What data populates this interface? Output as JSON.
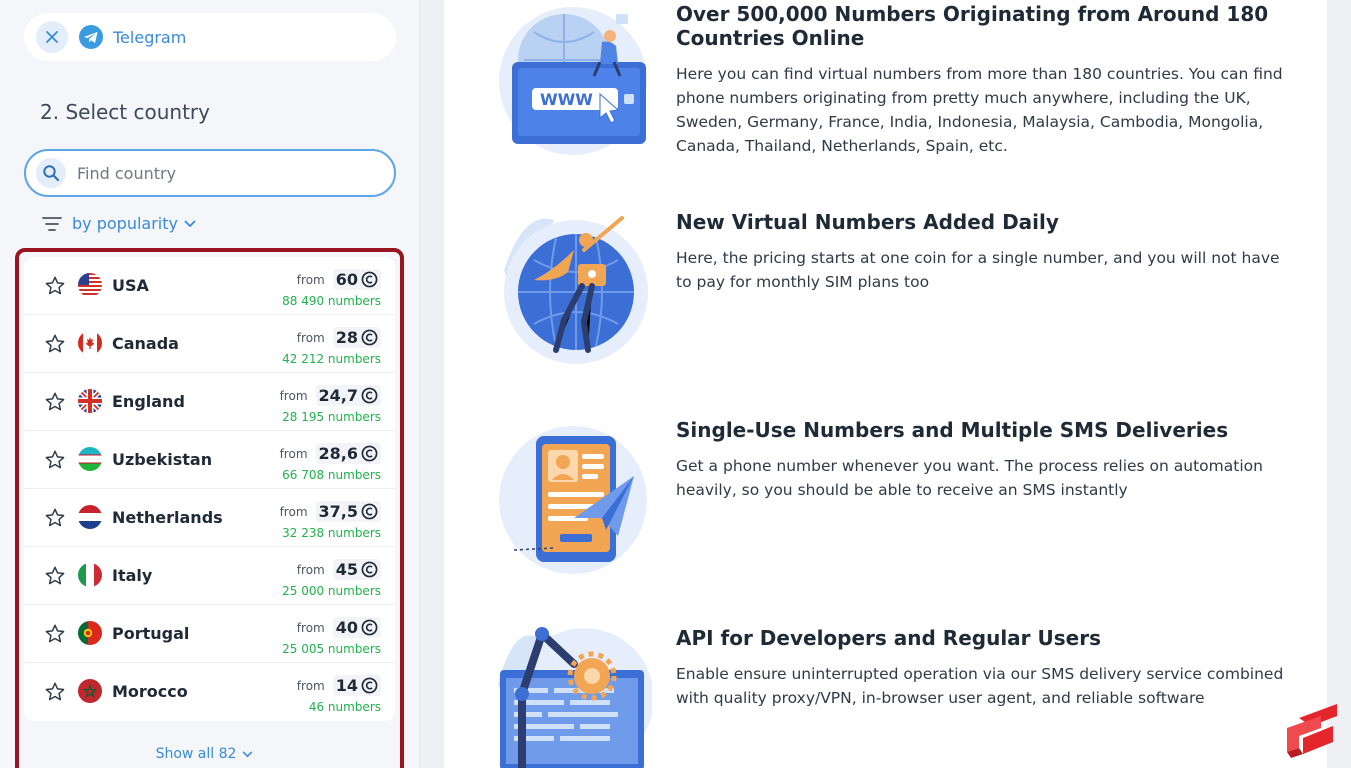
{
  "service": {
    "name": "Telegram"
  },
  "step": {
    "title": "2. Select country"
  },
  "search": {
    "placeholder": "Find country"
  },
  "sort": {
    "label": "by popularity"
  },
  "countries": [
    {
      "name": "USA",
      "from": "from",
      "price": "60",
      "numbers": "88 490 numbers"
    },
    {
      "name": "Canada",
      "from": "from",
      "price": "28",
      "numbers": "42 212 numbers"
    },
    {
      "name": "England",
      "from": "from",
      "price": "24,7",
      "numbers": "28 195 numbers"
    },
    {
      "name": "Uzbekistan",
      "from": "from",
      "price": "28,6",
      "numbers": "66 708 numbers"
    },
    {
      "name": "Netherlands",
      "from": "from",
      "price": "37,5",
      "numbers": "32 238 numbers"
    },
    {
      "name": "Italy",
      "from": "from",
      "price": "45",
      "numbers": "25 000 numbers"
    },
    {
      "name": "Portugal",
      "from": "from",
      "price": "40",
      "numbers": "25 005 numbers"
    },
    {
      "name": "Morocco",
      "from": "from",
      "price": "14",
      "numbers": "46 numbers"
    }
  ],
  "show_all": {
    "label": "Show all 82"
  },
  "features": [
    {
      "title": "Over 500,000 Numbers Originating from Around 180 Countries Online",
      "text": "Here you can find virtual numbers from more than 180 countries. You can find phone numbers originating from pretty much anywhere, including the UK, Sweden, Germany, France, India, Indonesia, Malaysia, Cambodia, Mongolia, Canada, Thailand, Netherlands, Spain, etc.",
      "art_text": "WWW"
    },
    {
      "title": "New Virtual Numbers Added Daily",
      "text": "Here, the pricing starts at one coin for a single number, and you will not have to pay for monthly SIM plans too"
    },
    {
      "title": "Single-Use Numbers and Multiple SMS Deliveries",
      "text": "Get a phone number whenever you want. The process relies on automation heavily, so you should be able to receive an SMS instantly"
    },
    {
      "title": "API for Developers and Regular Users",
      "text": "Enable ensure uninterrupted operation via our SMS delivery service combined with quality proxy/VPN, in-browser user agent, and reliable software"
    }
  ],
  "colors": {
    "accent": "#3b8ad9",
    "highlight_border": "#9a1420",
    "count_green": "#22b14c"
  }
}
